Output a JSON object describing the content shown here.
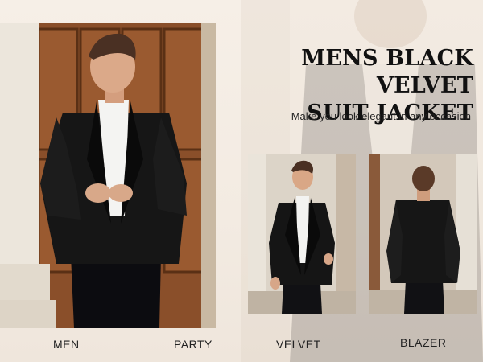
{
  "header": {
    "title_line1": "MENS BLACK VELVET",
    "title_line2": "SUIT JACKET",
    "subtitle": "Make you look elegant in any occasion"
  },
  "tags": {
    "men": "MEN",
    "party": "PARTY",
    "velvet": "VELVET",
    "blazer": "BLAZER"
  },
  "images": {
    "main": "man-in-black-velvet-shawl-collar-jacket-front-photo",
    "velvet": "man-wearing-jacket-front-view-photo",
    "blazer": "man-wearing-jacket-back-view-photo"
  },
  "colors": {
    "background": "#f4ece3",
    "door_wood": "#7a4524",
    "jacket": "#151515",
    "text": "#111111"
  }
}
